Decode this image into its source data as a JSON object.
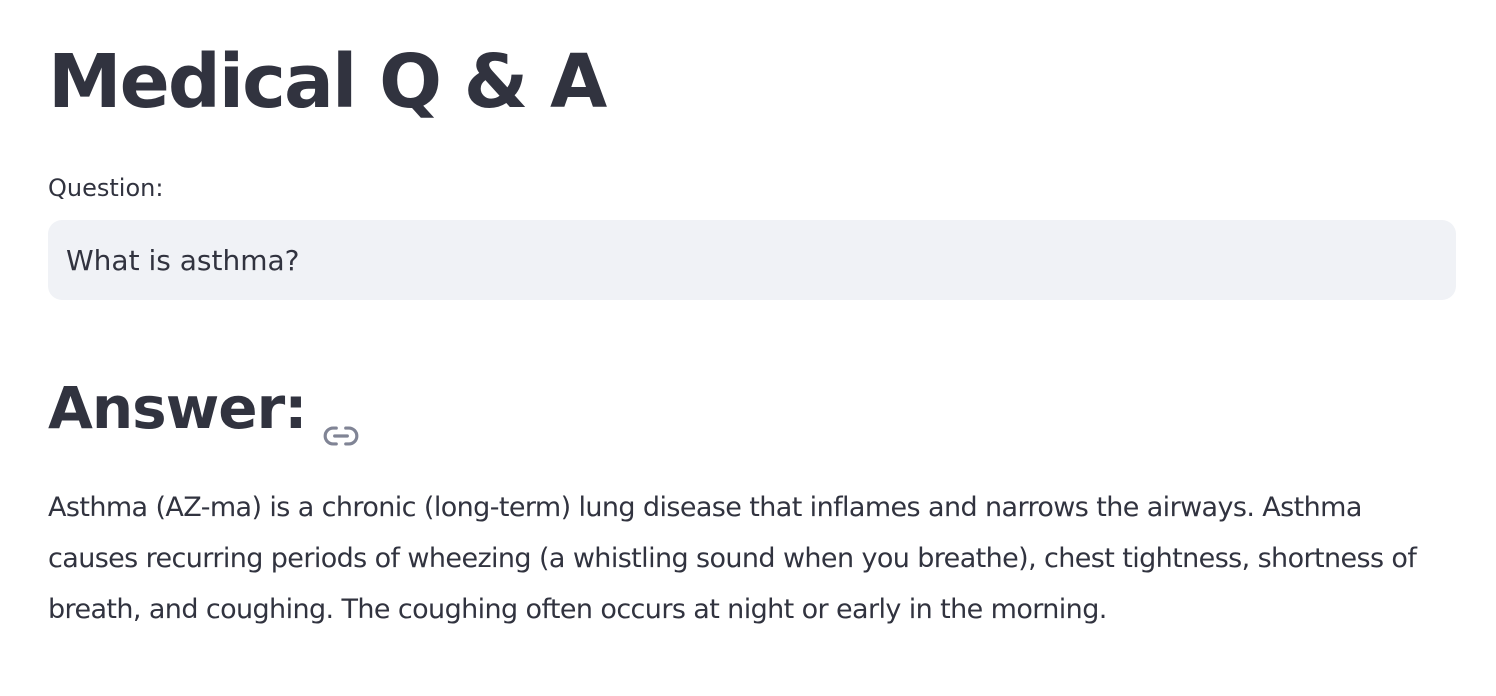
{
  "header": {
    "title": "Medical Q & A"
  },
  "question": {
    "label": "Question:",
    "value": "What is asthma?",
    "placeholder": ""
  },
  "answer": {
    "heading": "Answer:",
    "anchor_icon": "link-icon",
    "text": "Asthma (AZ-ma) is a chronic (long-term) lung disease that inflames and narrows the airways. Asthma causes recurring periods of wheezing (a whistling sound when you breathe), chest tightness, shortness of breath, and coughing. The coughing often occurs at night or early in the morning."
  },
  "colors": {
    "text": "#31333f",
    "input_background": "#f0f2f6",
    "icon": "#808495"
  }
}
